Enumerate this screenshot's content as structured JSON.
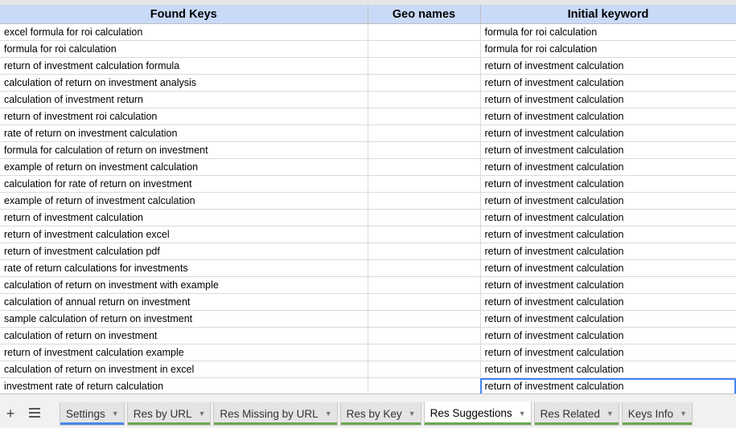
{
  "columns": {
    "found_keys": "Found Keys",
    "geo_names": "Geo names",
    "initial_keyword": "Initial keyword"
  },
  "rows": [
    {
      "found": "excel formula for roi calculation",
      "geo": "",
      "initial": "formula for roi calculation"
    },
    {
      "found": "formula for roi calculation",
      "geo": "",
      "initial": "formula for roi calculation"
    },
    {
      "found": "return of investment calculation formula",
      "geo": "",
      "initial": "return of investment calculation"
    },
    {
      "found": "calculation of return on investment analysis",
      "geo": "",
      "initial": "return of investment calculation"
    },
    {
      "found": "calculation of investment return",
      "geo": "",
      "initial": "return of investment calculation"
    },
    {
      "found": "return of investment roi calculation",
      "geo": "",
      "initial": "return of investment calculation"
    },
    {
      "found": "rate of return on investment calculation",
      "geo": "",
      "initial": "return of investment calculation"
    },
    {
      "found": "formula for calculation of return on investment",
      "geo": "",
      "initial": "return of investment calculation"
    },
    {
      "found": "example of return on investment calculation",
      "geo": "",
      "initial": "return of investment calculation"
    },
    {
      "found": "calculation for rate of return on investment",
      "geo": "",
      "initial": "return of investment calculation"
    },
    {
      "found": "example of return of investment calculation",
      "geo": "",
      "initial": "return of investment calculation"
    },
    {
      "found": "return of investment calculation",
      "geo": "",
      "initial": "return of investment calculation"
    },
    {
      "found": "return of investment calculation excel",
      "geo": "",
      "initial": "return of investment calculation"
    },
    {
      "found": "return of investment calculation pdf",
      "geo": "",
      "initial": "return of investment calculation"
    },
    {
      "found": "rate of return calculations for investments",
      "geo": "",
      "initial": "return of investment calculation"
    },
    {
      "found": "calculation of return on investment with example",
      "geo": "",
      "initial": "return of investment calculation"
    },
    {
      "found": "calculation of annual return on investment",
      "geo": "",
      "initial": "return of investment calculation"
    },
    {
      "found": "sample calculation of return on investment",
      "geo": "",
      "initial": "return of investment calculation"
    },
    {
      "found": "calculation of return on investment",
      "geo": "",
      "initial": "return of investment calculation"
    },
    {
      "found": "return of investment calculation example",
      "geo": "",
      "initial": "return of investment calculation"
    },
    {
      "found": "calculation of return on investment in excel",
      "geo": "",
      "initial": "return of investment calculation"
    },
    {
      "found": "investment rate of return calculation",
      "geo": "",
      "initial": "return of investment calculation"
    }
  ],
  "tabbar": {
    "add_symbol": "+",
    "tabs": [
      {
        "label": "Settings",
        "color": "#4a86e8",
        "active": false
      },
      {
        "label": "Res by URL",
        "color": "#6aa84f",
        "active": false
      },
      {
        "label": "Res Missing by URL",
        "color": "#6aa84f",
        "active": false
      },
      {
        "label": "Res by Key",
        "color": "#6aa84f",
        "active": false
      },
      {
        "label": "Res Suggestions",
        "color": "#6aa84f",
        "active": true
      },
      {
        "label": "Res Related",
        "color": "#6aa84f",
        "active": false
      },
      {
        "label": "Keys Info",
        "color": "#6aa84f",
        "active": false
      }
    ]
  },
  "colors": {
    "header_bg": "#c9daf8",
    "selection": "#4285f4"
  },
  "icons": {
    "add_sheet": "plus-icon",
    "all_sheets": "hamburger-menu-icon",
    "tab_dropdown": "triangle-down-icon"
  }
}
